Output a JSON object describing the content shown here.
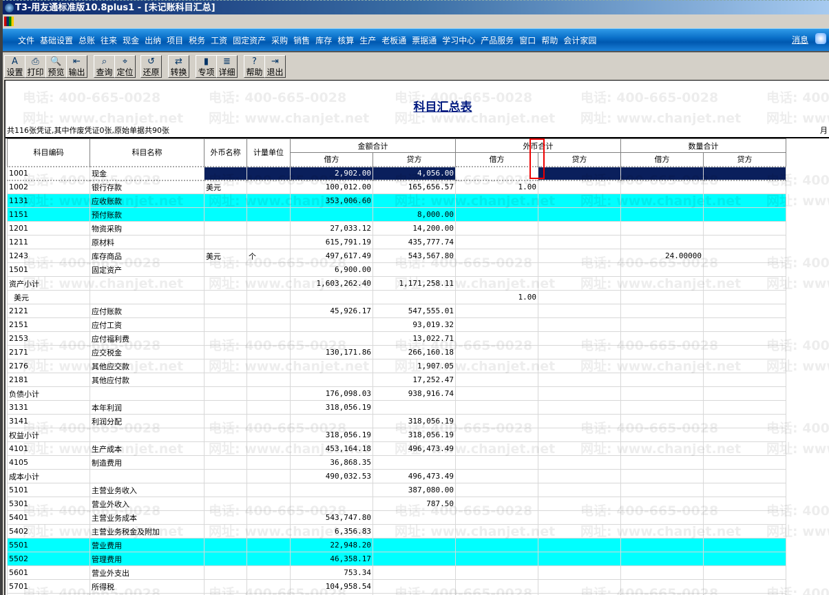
{
  "window": {
    "title": "T3-用友通标准版10.8plus1 - [未记账科目汇总]"
  },
  "menu": {
    "items": [
      "文件",
      "基础设置",
      "总账",
      "往来",
      "现金",
      "出纳",
      "项目",
      "税务",
      "工资",
      "固定资产",
      "采购",
      "销售",
      "库存",
      "核算",
      "生产",
      "老板通",
      "票据通",
      "学习中心",
      "产品服务",
      "窗口",
      "帮助",
      "会计家园"
    ],
    "message": "消息"
  },
  "toolbar": [
    {
      "label": "设置",
      "icon": "settings-icon",
      "glyph": "A"
    },
    {
      "label": "打印",
      "icon": "print-icon",
      "glyph": "⎙"
    },
    {
      "label": "预览",
      "icon": "preview-icon",
      "glyph": "🔍"
    },
    {
      "label": "输出",
      "icon": "export-icon",
      "glyph": "⇤"
    },
    {
      "label": "查询",
      "icon": "binoculars-icon",
      "glyph": "⌕"
    },
    {
      "label": "定位",
      "icon": "locate-icon",
      "glyph": "⌖"
    },
    {
      "label": "还原",
      "icon": "restore-icon",
      "glyph": "↺"
    },
    {
      "label": "转换",
      "icon": "convert-icon",
      "glyph": "⇄"
    },
    {
      "label": "专项",
      "icon": "book-icon",
      "glyph": "▮"
    },
    {
      "label": "详细",
      "icon": "detail-icon",
      "glyph": "≣"
    },
    {
      "label": "帮助",
      "icon": "help-icon",
      "glyph": "?"
    },
    {
      "label": "退出",
      "icon": "exit-icon",
      "glyph": "⇥"
    }
  ],
  "watermark": {
    "phone": "电话: 400-665-0028",
    "web": "网址: www.chanjet.net"
  },
  "report": {
    "title": "科目汇总表",
    "info": "共116张凭证,其中作废凭证0张,原始单据共90张",
    "month": "月",
    "headers": {
      "code": "科目编码",
      "name": "科目名称",
      "currency": "外币名称",
      "unit": "计量单位",
      "amount": "金额合计",
      "foreign": "外币合计",
      "quantity": "数量合计",
      "debit": "借方",
      "credit": "贷方"
    },
    "rows": [
      [
        "1001",
        "现金",
        "",
        "",
        "2,902.00",
        "4,056.00",
        "",
        "",
        "",
        ""
      ],
      [
        "1002",
        "银行存款",
        "美元",
        "",
        "100,012.00",
        "165,656.57",
        "1.00",
        "",
        "",
        ""
      ],
      [
        "1131",
        "应收账款",
        "",
        "",
        "353,006.60",
        "",
        "",
        "",
        "",
        ""
      ],
      [
        "1151",
        "预付账款",
        "",
        "",
        "",
        "8,000.00",
        "",
        "",
        "",
        ""
      ],
      [
        "1201",
        "物资采购",
        "",
        "",
        "27,033.12",
        "14,200.00",
        "",
        "",
        "",
        ""
      ],
      [
        "1211",
        "原材料",
        "",
        "",
        "615,791.19",
        "435,777.74",
        "",
        "",
        "",
        ""
      ],
      [
        "1243",
        "库存商品",
        "美元",
        "个",
        "497,617.49",
        "543,567.80",
        "",
        "",
        "24.00000",
        ""
      ],
      [
        "1501",
        "固定资产",
        "",
        "",
        "6,900.00",
        "",
        "",
        "",
        "",
        ""
      ],
      [
        "资产小计",
        "",
        "",
        "",
        "1,603,262.40",
        "1,171,258.11",
        "",
        "",
        "",
        ""
      ],
      [
        "  美元",
        "",
        "",
        "",
        "",
        "",
        "1.00",
        "",
        "",
        ""
      ],
      [
        "2121",
        "应付账款",
        "",
        "",
        "45,926.17",
        "547,555.01",
        "",
        "",
        "",
        ""
      ],
      [
        "2151",
        "应付工资",
        "",
        "",
        "",
        "93,019.32",
        "",
        "",
        "",
        ""
      ],
      [
        "2153",
        "应付福利费",
        "",
        "",
        "",
        "13,022.71",
        "",
        "",
        "",
        ""
      ],
      [
        "2171",
        "应交税金",
        "",
        "",
        "130,171.86",
        "266,160.18",
        "",
        "",
        "",
        ""
      ],
      [
        "2176",
        "其他应交款",
        "",
        "",
        "",
        "1,907.05",
        "",
        "",
        "",
        ""
      ],
      [
        "2181",
        "其他应付款",
        "",
        "",
        "",
        "17,252.47",
        "",
        "",
        "",
        ""
      ],
      [
        "负债小计",
        "",
        "",
        "",
        "176,098.03",
        "938,916.74",
        "",
        "",
        "",
        ""
      ],
      [
        "3131",
        "本年利润",
        "",
        "",
        "318,056.19",
        "",
        "",
        "",
        "",
        ""
      ],
      [
        "3141",
        "利润分配",
        "",
        "",
        "",
        "318,056.19",
        "",
        "",
        "",
        ""
      ],
      [
        "权益小计",
        "",
        "",
        "",
        "318,056.19",
        "318,056.19",
        "",
        "",
        "",
        ""
      ],
      [
        "4101",
        "生产成本",
        "",
        "",
        "453,164.18",
        "496,473.49",
        "",
        "",
        "",
        ""
      ],
      [
        "4105",
        "制造费用",
        "",
        "",
        "36,868.35",
        "",
        "",
        "",
        "",
        ""
      ],
      [
        "成本小计",
        "",
        "",
        "",
        "490,032.53",
        "496,473.49",
        "",
        "",
        "",
        ""
      ],
      [
        "5101",
        "主营业务收入",
        "",
        "",
        "",
        "387,080.00",
        "",
        "",
        "",
        ""
      ],
      [
        "5301",
        "营业外收入",
        "",
        "",
        "",
        "787.50",
        "",
        "",
        "",
        ""
      ],
      [
        "5401",
        "主营业务成本",
        "",
        "",
        "543,747.80",
        "",
        "",
        "",
        "",
        ""
      ],
      [
        "5402",
        "主营业务税金及附加",
        "",
        "",
        "6,356.83",
        "",
        "",
        "",
        "",
        ""
      ],
      [
        "5501",
        "营业费用",
        "",
        "",
        "22,948.20",
        "",
        "",
        "",
        "",
        ""
      ],
      [
        "5502",
        "管理费用",
        "",
        "",
        "46,358.17",
        "",
        "",
        "",
        "",
        ""
      ],
      [
        "5601",
        "营业外支出",
        "",
        "",
        "753.34",
        "",
        "",
        "",
        "",
        ""
      ],
      [
        "5701",
        "所得税",
        "",
        "",
        "104,958.54",
        "",
        "",
        "",
        "",
        ""
      ],
      [
        "",
        "",
        "",
        "",
        "",
        "",
        "",
        "",
        "",
        ""
      ]
    ],
    "highlight_rows": [
      "1131",
      "1151",
      "5501",
      "5502"
    ],
    "selected_row": "1001",
    "colors": {
      "highlight": "#00ffff",
      "selection": "#0a1f5c",
      "title": "#001a80"
    }
  }
}
